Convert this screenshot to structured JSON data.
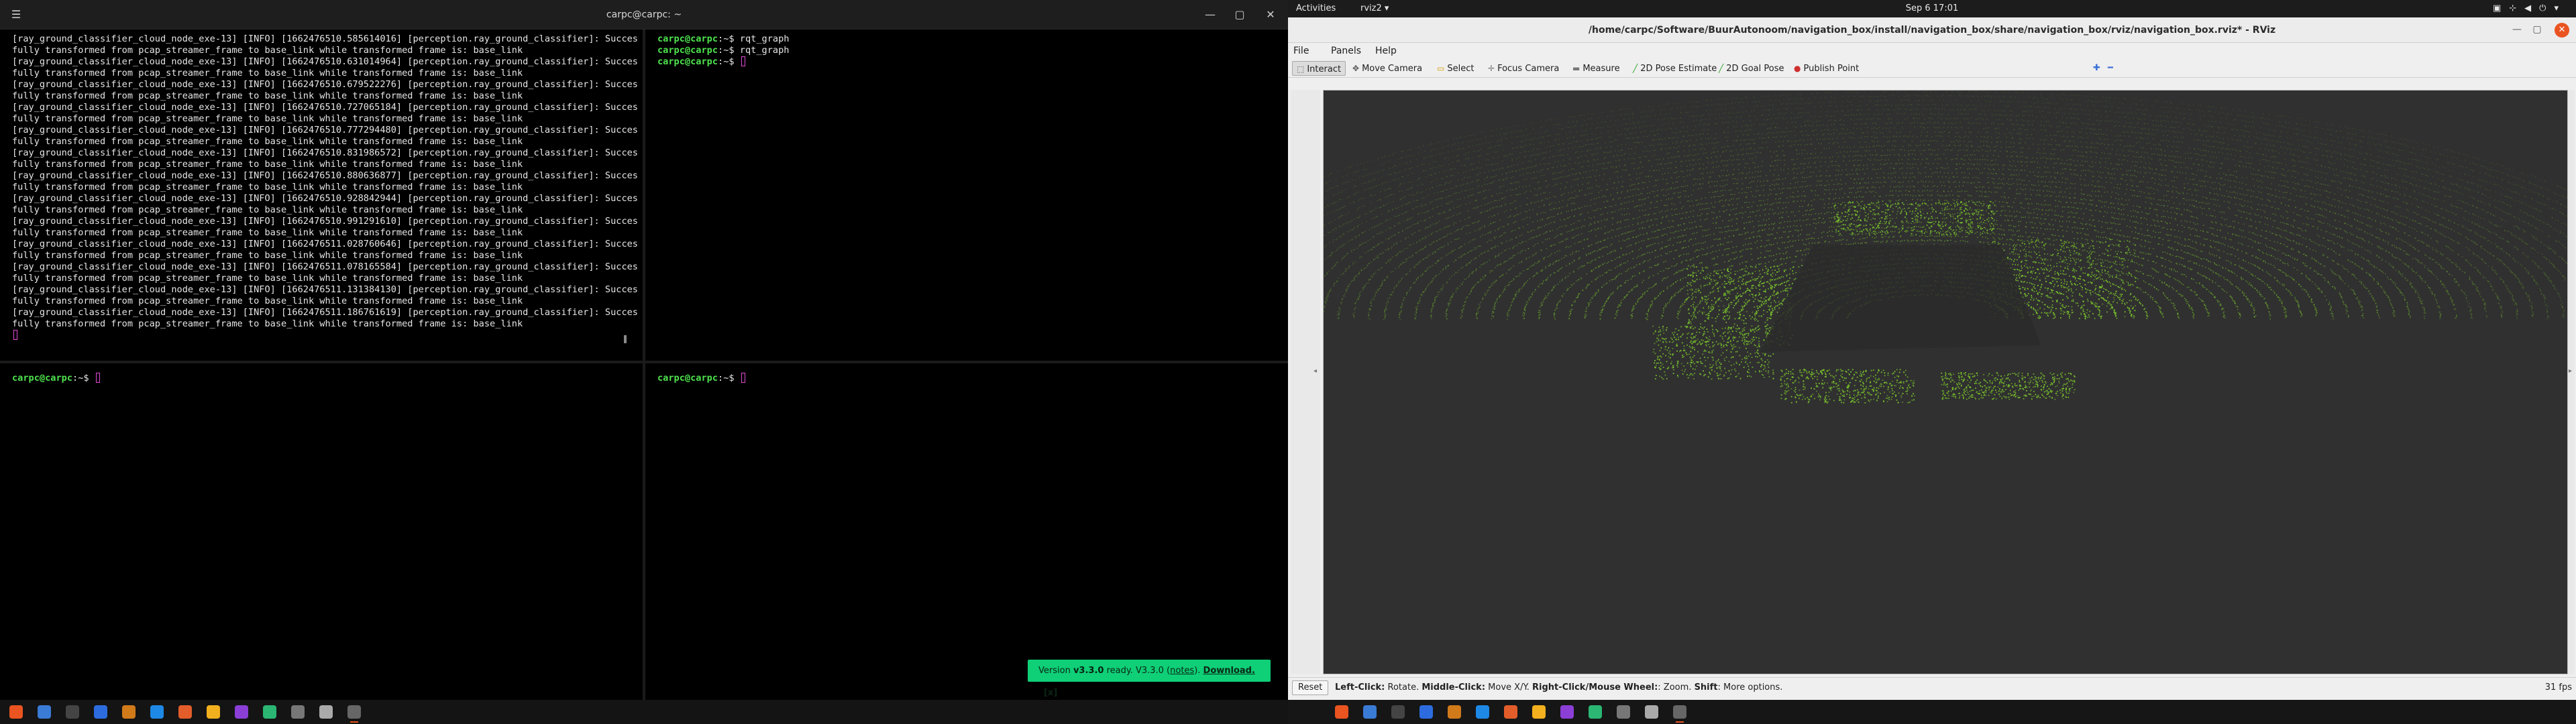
{
  "terminal": {
    "title": "carpc@carpc: ~",
    "log_lines": [
      "[ray_ground_classifier_cloud_node_exe-13] [INFO] [1662476510.585614016] [perception.ray_ground_classifier]: Succes",
      "fully transformed from pcap_streamer_frame to base_link while transformed frame is: base_link",
      "[ray_ground_classifier_cloud_node_exe-13] [INFO] [1662476510.631014964] [perception.ray_ground_classifier]: Succes",
      "fully transformed from pcap_streamer_frame to base_link while transformed frame is: base_link",
      "[ray_ground_classifier_cloud_node_exe-13] [INFO] [1662476510.679522276] [perception.ray_ground_classifier]: Succes",
      "fully transformed from pcap_streamer_frame to base_link while transformed frame is: base_link",
      "[ray_ground_classifier_cloud_node_exe-13] [INFO] [1662476510.727065184] [perception.ray_ground_classifier]: Succes",
      "fully transformed from pcap_streamer_frame to base_link while transformed frame is: base_link",
      "[ray_ground_classifier_cloud_node_exe-13] [INFO] [1662476510.777294480] [perception.ray_ground_classifier]: Succes",
      "fully transformed from pcap_streamer_frame to base_link while transformed frame is: base_link",
      "[ray_ground_classifier_cloud_node_exe-13] [INFO] [1662476510.831986572] [perception.ray_ground_classifier]: Succes",
      "fully transformed from pcap_streamer_frame to base_link while transformed frame is: base_link",
      "[ray_ground_classifier_cloud_node_exe-13] [INFO] [1662476510.880636877] [perception.ray_ground_classifier]: Succes",
      "fully transformed from pcap_streamer_frame to base_link while transformed frame is: base_link",
      "[ray_ground_classifier_cloud_node_exe-13] [INFO] [1662476510.928842944] [perception.ray_ground_classifier]: Succes",
      "fully transformed from pcap_streamer_frame to base_link while transformed frame is: base_link",
      "[ray_ground_classifier_cloud_node_exe-13] [INFO] [1662476510.991291610] [perception.ray_ground_classifier]: Succes",
      "fully transformed from pcap_streamer_frame to base_link while transformed frame is: base_link",
      "[ray_ground_classifier_cloud_node_exe-13] [INFO] [1662476511.028760646] [perception.ray_ground_classifier]: Succes",
      "fully transformed from pcap_streamer_frame to base_link while transformed frame is: base_link",
      "[ray_ground_classifier_cloud_node_exe-13] [INFO] [1662476511.078165584] [perception.ray_ground_classifier]: Succes",
      "fully transformed from pcap_streamer_frame to base_link while transformed frame is: base_link",
      "[ray_ground_classifier_cloud_node_exe-13] [INFO] [1662476511.131384130] [perception.ray_ground_classifier]: Succes",
      "fully transformed from pcap_streamer_frame to base_link while transformed frame is: base_link",
      "[ray_ground_classifier_cloud_node_exe-13] [INFO] [1662476511.186761619] [perception.ray_ground_classifier]: Succes",
      "fully transformed from pcap_streamer_frame to base_link while transformed frame is: base_link"
    ],
    "prompt_user": "carpc@carpc",
    "prompt_path": ":~$",
    "top_right_history": [
      {
        "user": "carpc@carpc",
        "path": ":~$ ",
        "cmd": "rqt_graph"
      },
      {
        "user": "carpc@carpc",
        "path": ":~$ ",
        "cmd": "rqt_graph"
      },
      {
        "user": "carpc@carpc",
        "path": ":~$ ",
        "cmd": ""
      }
    ],
    "toast": {
      "prefix": "Version ",
      "version": "v3.3.0",
      "mid": " ready. V3.3.0 (",
      "notes": "notes",
      "after": "). ",
      "download": "Download.",
      "close": "[x]"
    },
    "icons": {
      "menu": "menu-icon",
      "minimize": "minimize-icon",
      "maximize": "maximize-icon",
      "close": "close-icon"
    }
  },
  "gnome": {
    "activities": "Activities",
    "app_menu": "rviz2 ▾",
    "clock": "Sep 6  17:01"
  },
  "rviz": {
    "title": "/home/carpc/Software/BuurAutonoom/navigation_box/install/navigation_box/share/navigation_box/rviz/navigation_box.rviz* - RViz",
    "menu": [
      "File",
      "Panels",
      "Help"
    ],
    "tools": [
      {
        "label": "Interact",
        "icon": "interact-icon",
        "glyph": "⬚",
        "color": "#555555"
      },
      {
        "label": "Move Camera",
        "icon": "move-camera-icon",
        "glyph": "✥",
        "color": "#555555"
      },
      {
        "label": "Select",
        "icon": "select-icon",
        "glyph": "▭",
        "color": "#d4a000"
      },
      {
        "label": "Focus Camera",
        "icon": "focus-camera-icon",
        "glyph": "✛",
        "color": "#777777"
      },
      {
        "label": "Measure",
        "icon": "measure-icon",
        "glyph": "▬",
        "color": "#777777"
      },
      {
        "label": "2D Pose Estimate",
        "icon": "pose-estimate-icon",
        "glyph": "╱",
        "color": "#2fa52f"
      },
      {
        "label": "2D Goal Pose",
        "icon": "goal-pose-icon",
        "glyph": "╱",
        "color": "#2fa52f"
      },
      {
        "label": "Publish Point",
        "icon": "publish-point-icon",
        "glyph": "●",
        "color": "#d03030"
      }
    ],
    "status": {
      "reset": "Reset",
      "hint_parts": [
        {
          "b": "Left-Click:",
          "t": " Rotate. "
        },
        {
          "b": "Middle-Click:",
          "t": " Move X/Y. "
        },
        {
          "b": "Right-Click/Mouse Wheel:",
          "t": ": Zoom. "
        },
        {
          "b": "Shift",
          "t": ": More options."
        }
      ],
      "fps": "31 fps"
    },
    "pointcloud_color": "#7bc72b",
    "background_color": "#303030"
  }
}
